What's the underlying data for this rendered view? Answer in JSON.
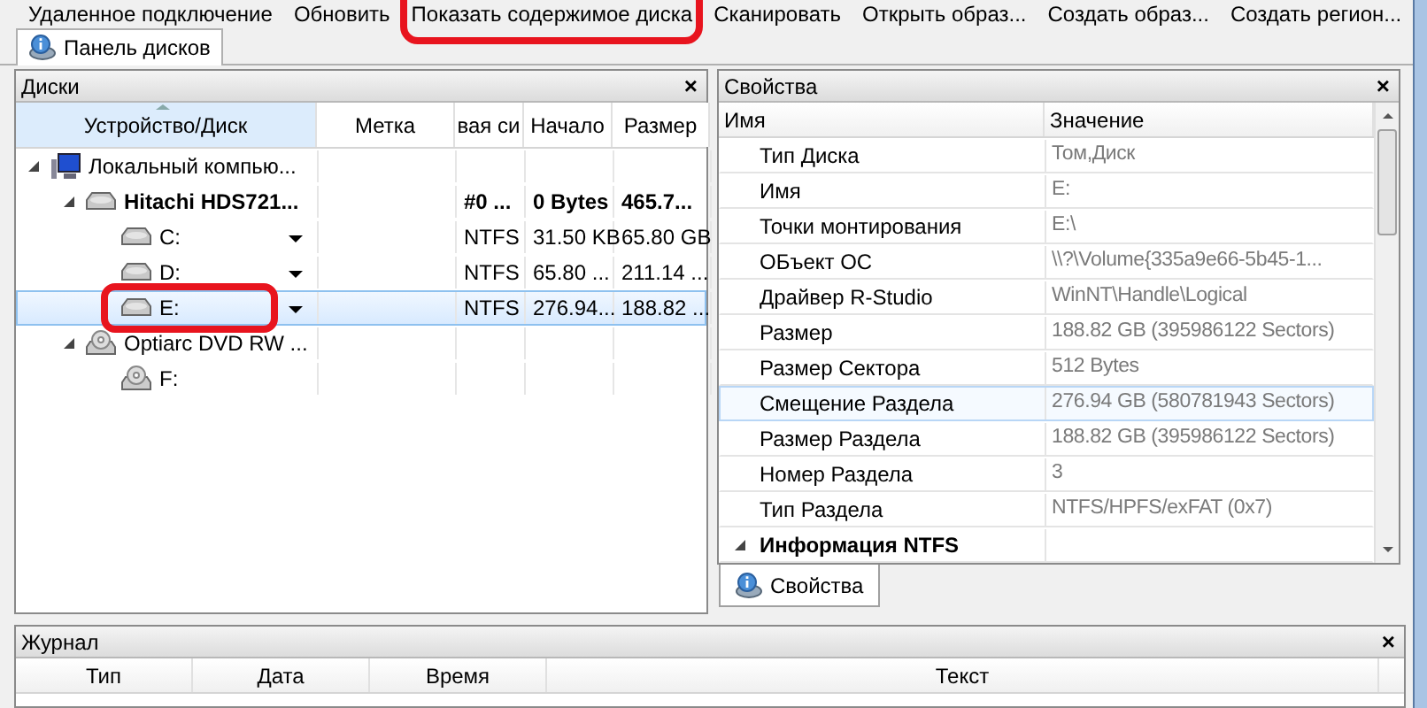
{
  "toolbar": [
    {
      "label": "Удаленное подключение",
      "highlight": false
    },
    {
      "label": "Обновить",
      "highlight": false
    },
    {
      "label": "Показать содержимое диска",
      "highlight": true
    },
    {
      "label": "Сканировать",
      "highlight": false
    },
    {
      "label": "Открыть образ...",
      "highlight": false
    },
    {
      "label": "Создать образ...",
      "highlight": false
    },
    {
      "label": "Создать регион...",
      "highlight": false
    }
  ],
  "top_tabs": [
    {
      "label": "Панель дисков",
      "selected": true
    }
  ],
  "disks_panel": {
    "title": "Диски",
    "close": "×",
    "columns": [
      "Устройство/Диск",
      "Метка",
      "вая си",
      "Начало",
      "Размер"
    ],
    "tree": [
      {
        "kind": "computer",
        "name": "Локальный компью...",
        "expanded": true,
        "selected": false,
        "highlight": false,
        "cells": [
          "",
          "",
          "",
          ""
        ],
        "children": [
          {
            "kind": "hdd",
            "name": "Hitachi HDS721...",
            "expanded": true,
            "selected": false,
            "highlight": false,
            "cells": [
              "",
              "#0 ...",
              "0 Bytes",
              "465.7..."
            ],
            "children": [
              {
                "kind": "partition",
                "name": "C:",
                "selected": false,
                "highlight": false,
                "cells": [
                  "",
                  "NTFS",
                  "31.50 KB",
                  "65.80 GB"
                ]
              },
              {
                "kind": "partition",
                "name": "D:",
                "selected": false,
                "highlight": false,
                "cells": [
                  "",
                  "NTFS",
                  "65.80 ...",
                  "211.14 ..."
                ]
              },
              {
                "kind": "partition",
                "name": "E:",
                "selected": true,
                "highlight": true,
                "cells": [
                  "",
                  "NTFS",
                  "276.94...",
                  "188.82 ..."
                ]
              }
            ]
          },
          {
            "kind": "dvd",
            "name": "Optiarc DVD RW ...",
            "expanded": true,
            "selected": false,
            "highlight": false,
            "cells": [
              "",
              "",
              "",
              ""
            ],
            "children": [
              {
                "kind": "cd",
                "name": "F:",
                "selected": false,
                "highlight": false,
                "cells": [
                  "",
                  "",
                  "",
                  ""
                ]
              }
            ]
          }
        ]
      }
    ]
  },
  "properties_panel": {
    "title": "Свойства",
    "close": "×",
    "columns": [
      "Имя",
      "Значение"
    ],
    "rows": [
      {
        "kind": "prop",
        "name": "Тип Диска",
        "value": "Том,Диск",
        "selected": false
      },
      {
        "kind": "prop",
        "name": "Имя",
        "value": "E:",
        "selected": false
      },
      {
        "kind": "prop",
        "name": "Точки монтирования",
        "value": "E:\\",
        "selected": false
      },
      {
        "kind": "prop",
        "name": "ОБъект ОС",
        "value": "\\\\?\\Volume{335a9e66-5b45-1...",
        "selected": false
      },
      {
        "kind": "prop",
        "name": "Драйвер R-Studio",
        "value": "WinNT\\Handle\\Logical",
        "selected": false
      },
      {
        "kind": "prop",
        "name": "Размер",
        "value": "188.82 GB (395986122 Sectors)",
        "selected": false
      },
      {
        "kind": "prop",
        "name": "Размер Сектора",
        "value": "512 Bytes",
        "selected": false
      },
      {
        "kind": "prop",
        "name": "Смещение Раздела",
        "value": "276.94 GB (580781943 Sectors)",
        "selected": true
      },
      {
        "kind": "prop",
        "name": "Размер Раздела",
        "value": "188.82 GB (395986122 Sectors)",
        "selected": false
      },
      {
        "kind": "prop",
        "name": "Номер Раздела",
        "value": "3",
        "selected": false
      },
      {
        "kind": "prop",
        "name": "Тип Раздела",
        "value": "NTFS/HPFS/exFAT (0x7)",
        "selected": false
      },
      {
        "kind": "group",
        "name": "Информация NTFS",
        "value": "",
        "selected": false
      }
    ],
    "tabs": [
      {
        "label": "Свойства",
        "selected": true
      }
    ]
  },
  "log_panel": {
    "title": "Журнал",
    "close": "×",
    "columns": [
      "Тип",
      "Дата",
      "Время",
      "Текст"
    ]
  }
}
